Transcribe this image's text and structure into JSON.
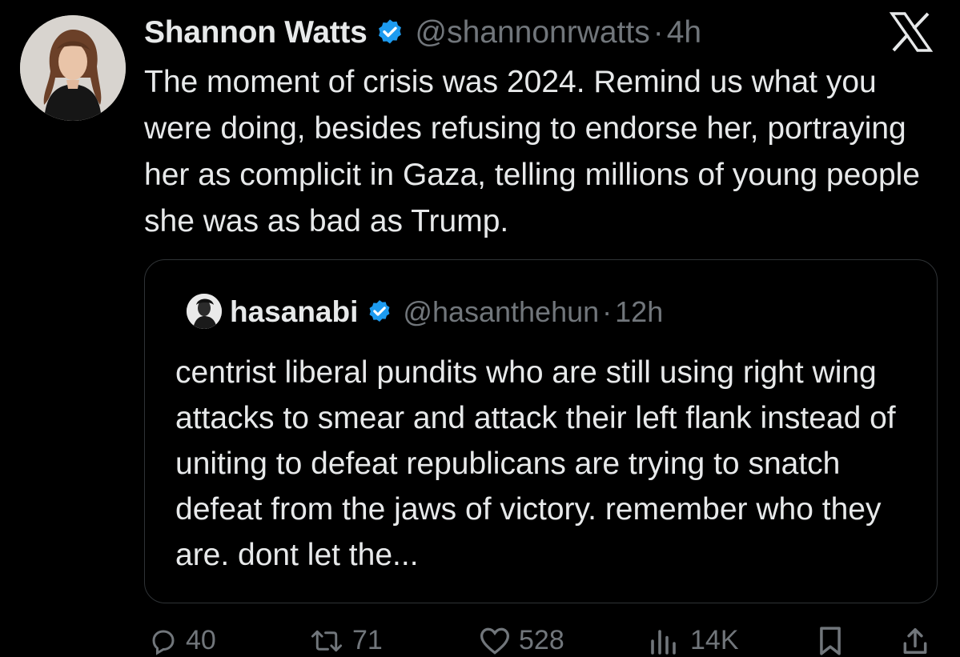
{
  "author": {
    "name": "Shannon Watts",
    "handle": "@shannonrwatts",
    "time": "4h",
    "verified_icon": "verified-badge-icon",
    "avatar": "avatar"
  },
  "brand": {
    "logo": "x-logo-icon",
    "color": "#e7e9ea"
  },
  "tweet": {
    "text": "The moment of crisis was 2024. Remind us what you were doing, besides refusing to endorse her, portraying her as complicit in Gaza, telling millions of young people she was as bad as Trump."
  },
  "quote": {
    "name": "hasanabi",
    "handle": "@hasanthehun",
    "time": "12h",
    "text": "centrist liberal pundits who are still using right wing attacks to smear and attack their left flank instead of uniting to defeat republicans are trying to snatch defeat from the jaws of victory. remember who they are. dont let the..."
  },
  "separator": "·",
  "actions": {
    "replies": "40",
    "reposts": "71",
    "likes": "528",
    "views": "14K",
    "icons": [
      "reply-icon",
      "repost-icon",
      "like-icon",
      "views-icon",
      "bookmark-icon",
      "share-icon"
    ]
  },
  "colors": {
    "background": "#000000",
    "text": "#e7e9ea",
    "secondary": "#71767b",
    "verified": "#1d9bf0",
    "border": "#2f3336"
  }
}
